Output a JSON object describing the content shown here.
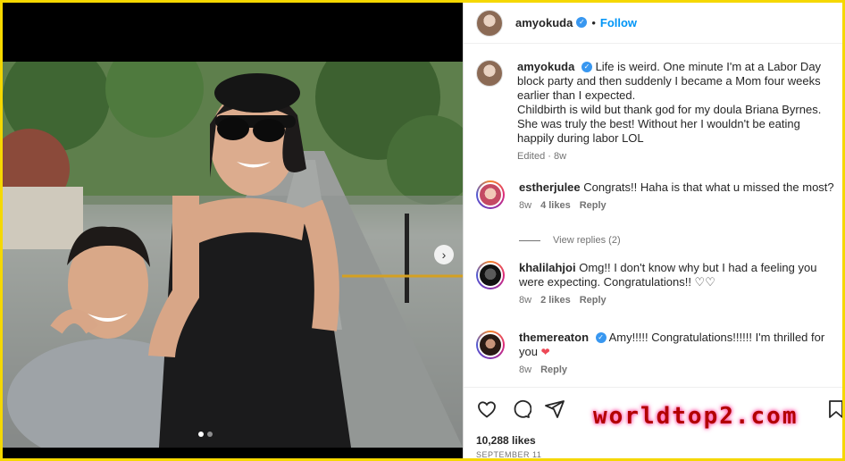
{
  "post": {
    "username": "amyokuda",
    "follow_label": "Follow",
    "separator": "•"
  },
  "caption": {
    "username": "amyokuda",
    "text": "Life is weird. One minute I'm at a Labor Day block party and then suddenly I became a Mom four weeks earlier than I expected.",
    "text2": "Childbirth is wild but thank god for my doula Briana Byrnes. She was truly the best! Without her I wouldn't be eating happily during labor LOL",
    "meta": "Edited · 8w"
  },
  "comments": [
    {
      "username": "estherjulee",
      "text": "Congrats!! Haha is that what u missed the most?",
      "time": "8w",
      "likes": "4 likes",
      "reply": "Reply"
    },
    {
      "username": "khalilahjoi",
      "text": "Omg!! I don't know why but I had a feeling you were expecting. Congratulations!! ♡♡",
      "time": "8w",
      "likes": "2 likes",
      "reply": "Reply"
    },
    {
      "username": "themereaton",
      "text": "Amy!!!!! Congratulations!!!!!! I'm thrilled for you",
      "time": "8w",
      "reply": "Reply"
    }
  ],
  "view_replies": "View replies (2)",
  "likes_count": "10,288 likes",
  "date": "SEPTEMBER 11",
  "watermark": "worldtop2.com",
  "icons": [
    "heart-icon",
    "comment-icon",
    "share-icon",
    "bookmark-icon",
    "verified-icon",
    "chevron-right-icon"
  ],
  "colors": {
    "accent": "#0095f6",
    "verified": "#3897f0",
    "frame": "#f5d800",
    "heart": "#ed4956"
  },
  "carousel": {
    "current": 1,
    "total": 2
  }
}
